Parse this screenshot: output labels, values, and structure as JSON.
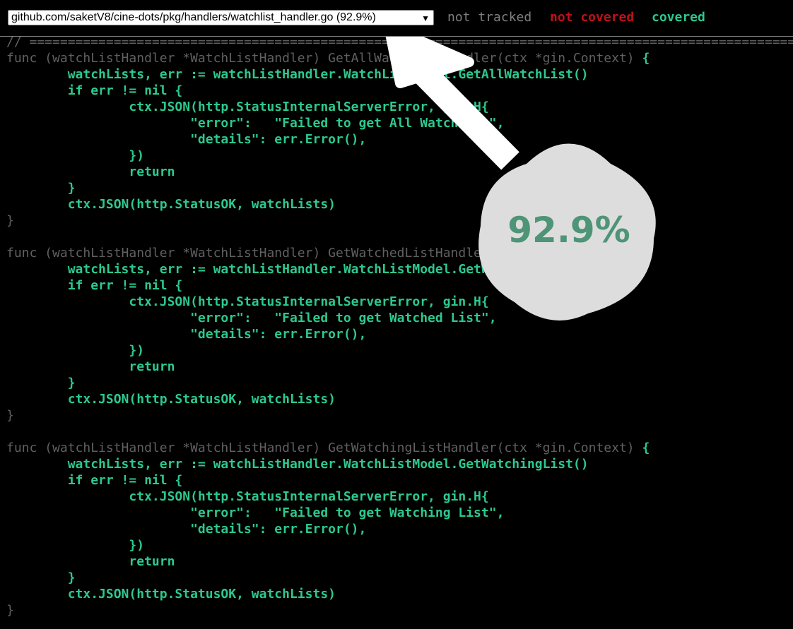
{
  "header": {
    "file_select_value": "github.com/saketV8/cine-dots/pkg/handlers/watchlist_handler.go (92.9%)",
    "legend": {
      "not_tracked": "not tracked",
      "not_covered": "not covered",
      "covered": "covered"
    }
  },
  "colors": {
    "background": "#000000",
    "not_tracked": "#808080",
    "not_covered": "#c0101a",
    "covered": "#2cc98e",
    "badge_fill": "#dddddd",
    "badge_text": "#4e9477",
    "arrow": "#ffffff"
  },
  "overlay": {
    "badge_label": "92.9%",
    "arrow_icon": "arrow-up-left-icon"
  },
  "code_lines": [
    [
      {
        "c": "nt",
        "t": "// ===================================================================================================="
      }
    ],
    [
      {
        "c": "nt",
        "t": "func (watchListHandler *WatchListHandler) GetAllWatchListHandler(ctx *gin.Context) "
      },
      {
        "c": "cov",
        "t": "{"
      }
    ],
    [
      {
        "c": "cov",
        "t": "        watchLists, err := watchListHandler.WatchListModel.GetAllWatchList()"
      }
    ],
    [
      {
        "c": "cov",
        "t": "        if err != nil {"
      }
    ],
    [
      {
        "c": "cov",
        "t": "                ctx.JSON(http.StatusInternalServerError, gin.H{"
      }
    ],
    [
      {
        "c": "cov",
        "t": "                        \"error\":   \"Failed to get All WatchList\","
      }
    ],
    [
      {
        "c": "cov",
        "t": "                        \"details\": err.Error(),"
      }
    ],
    [
      {
        "c": "cov",
        "t": "                })"
      }
    ],
    [
      {
        "c": "cov",
        "t": "                return"
      }
    ],
    [
      {
        "c": "cov",
        "t": "        }"
      }
    ],
    [
      {
        "c": "cov",
        "t": "        ctx.JSON(http.StatusOK, watchLists)"
      }
    ],
    [
      {
        "c": "nt",
        "t": "}"
      }
    ],
    [
      {
        "c": "nt",
        "t": ""
      }
    ],
    [
      {
        "c": "nt",
        "t": "func (watchListHandler *WatchListHandler) GetWatchedListHandler(ctx *gin.Context) "
      },
      {
        "c": "cov",
        "t": "{"
      }
    ],
    [
      {
        "c": "cov",
        "t": "        watchLists, err := watchListHandler.WatchListModel.GetWatchedList()"
      }
    ],
    [
      {
        "c": "cov",
        "t": "        if err != nil {"
      }
    ],
    [
      {
        "c": "cov",
        "t": "                ctx.JSON(http.StatusInternalServerError, gin.H{"
      }
    ],
    [
      {
        "c": "cov",
        "t": "                        \"error\":   \"Failed to get Watched List\","
      }
    ],
    [
      {
        "c": "cov",
        "t": "                        \"details\": err.Error(),"
      }
    ],
    [
      {
        "c": "cov",
        "t": "                })"
      }
    ],
    [
      {
        "c": "cov",
        "t": "                return"
      }
    ],
    [
      {
        "c": "cov",
        "t": "        }"
      }
    ],
    [
      {
        "c": "cov",
        "t": "        ctx.JSON(http.StatusOK, watchLists)"
      }
    ],
    [
      {
        "c": "nt",
        "t": "}"
      }
    ],
    [
      {
        "c": "nt",
        "t": ""
      }
    ],
    [
      {
        "c": "nt",
        "t": "func (watchListHandler *WatchListHandler) GetWatchingListHandler(ctx *gin.Context) "
      },
      {
        "c": "cov",
        "t": "{"
      }
    ],
    [
      {
        "c": "cov",
        "t": "        watchLists, err := watchListHandler.WatchListModel.GetWatchingList()"
      }
    ],
    [
      {
        "c": "cov",
        "t": "        if err != nil {"
      }
    ],
    [
      {
        "c": "cov",
        "t": "                ctx.JSON(http.StatusInternalServerError, gin.H{"
      }
    ],
    [
      {
        "c": "cov",
        "t": "                        \"error\":   \"Failed to get Watching List\","
      }
    ],
    [
      {
        "c": "cov",
        "t": "                        \"details\": err.Error(),"
      }
    ],
    [
      {
        "c": "cov",
        "t": "                })"
      }
    ],
    [
      {
        "c": "cov",
        "t": "                return"
      }
    ],
    [
      {
        "c": "cov",
        "t": "        }"
      }
    ],
    [
      {
        "c": "cov",
        "t": "        ctx.JSON(http.StatusOK, watchLists)"
      }
    ],
    [
      {
        "c": "nt",
        "t": "}"
      }
    ]
  ]
}
